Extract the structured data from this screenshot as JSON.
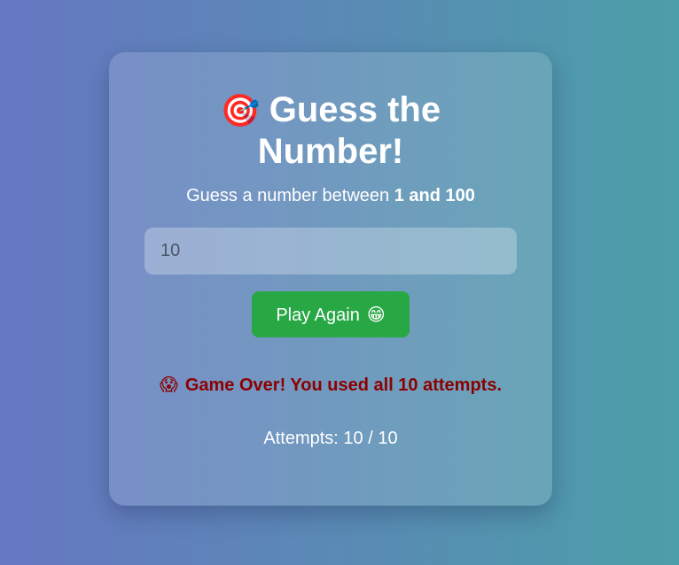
{
  "title": {
    "icon": "🎯",
    "text": "Guess the Number!"
  },
  "subtitle": {
    "prefix": "Guess a number between ",
    "range": "1 and 100"
  },
  "input": {
    "value": "10",
    "placeholder": ""
  },
  "play_again_button": {
    "label": "Play Again",
    "emoji": "😁",
    "color": "#28a745"
  },
  "message": {
    "emoji": "😱",
    "text": "Game Over! You used all 10 attempts.",
    "color": "#8b0000"
  },
  "attempts": {
    "text": "Attempts: 10 / 10"
  }
}
